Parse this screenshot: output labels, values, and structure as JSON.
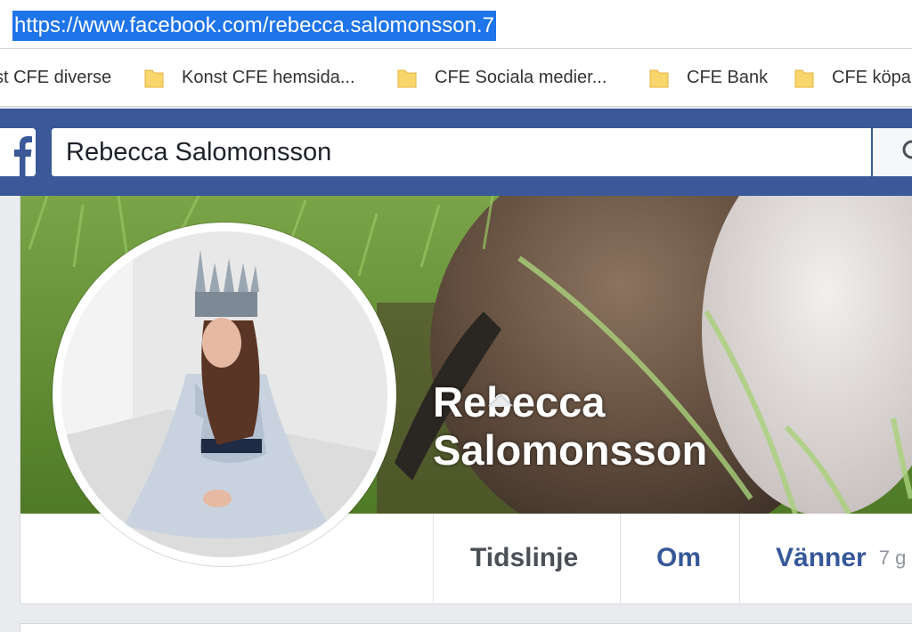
{
  "browser": {
    "url": "https://www.facebook.com/rebecca.salomonsson.7"
  },
  "bookmarks": [
    {
      "label": "st CFE diverse"
    },
    {
      "label": "Konst CFE hemsida..."
    },
    {
      "label": "CFE Sociala medier..."
    },
    {
      "label": "CFE Bank"
    },
    {
      "label": "CFE köpa"
    }
  ],
  "header": {
    "logo_icon": "facebook-f-icon",
    "search_value": "Rebecca Salomonsson",
    "search_icon": "search-icon",
    "brand_color": "#3b5998"
  },
  "profile": {
    "name_line1": "Rebecca",
    "name_line2": "Salomonsson",
    "tabs": [
      {
        "label": "Tidslinje"
      },
      {
        "label": "Om"
      },
      {
        "label": "Vänner"
      }
    ],
    "friends_count_partial": "7 g"
  }
}
